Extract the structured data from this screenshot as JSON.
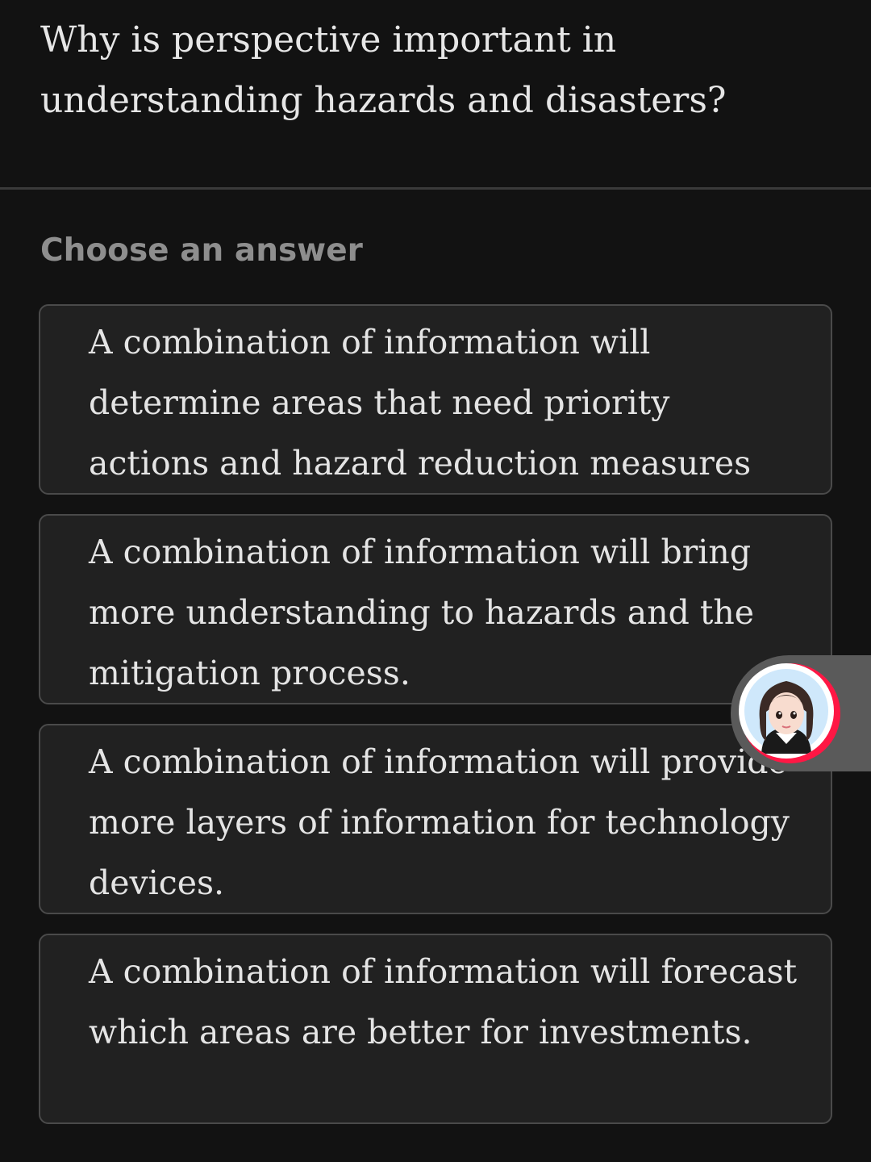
{
  "question": {
    "text": "Why is perspective important in understanding hazards and disasters?"
  },
  "prompt": {
    "label": "Choose an answer"
  },
  "options": [
    {
      "text": "A combination of information will determine areas that need priority actions and hazard reduction measures"
    },
    {
      "text": "A combination of information will bring more understanding to hazards and the mitigation process."
    },
    {
      "text": "A combination of information will provide more layers of information for technology devices."
    },
    {
      "text": "A combination of information will forecast which areas are better for investments."
    }
  ],
  "assistant": {
    "icon": "assistant-avatar-icon",
    "accent_color": "#ff1744"
  }
}
